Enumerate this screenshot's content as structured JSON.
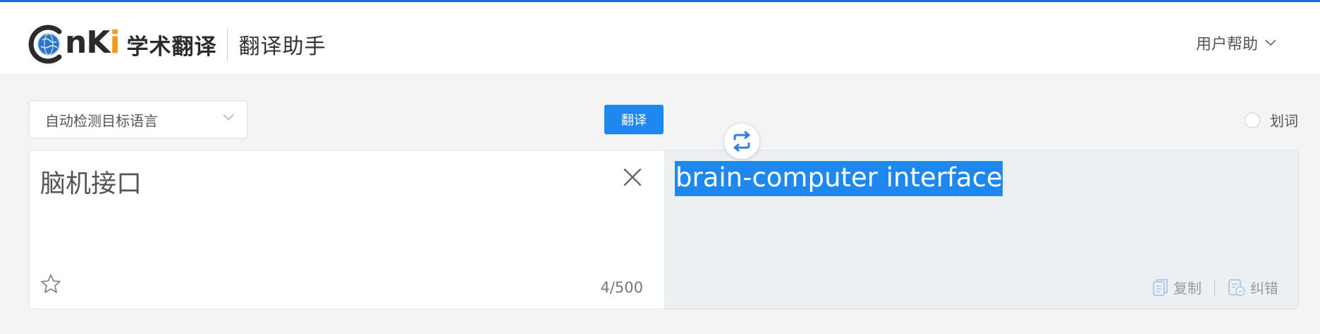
{
  "brand": {
    "logo_letters_left": "n",
    "logo_letters_k": "K",
    "logo_letters_i": "i",
    "title": "学术翻译",
    "subtitle": "翻译助手"
  },
  "header": {
    "help_label": "用户帮助"
  },
  "toolbar": {
    "source_language": "自动检测目标语言",
    "translate_label": "翻译",
    "selection_translate_label": "划词"
  },
  "source": {
    "text": "脑机接口",
    "char_count": "4/500"
  },
  "result": {
    "text": "brain-computer interface",
    "copy_label": "复制",
    "correct_label": "纠错"
  },
  "colors": {
    "accent": "#1e87f0",
    "top_bar": "#1e6ae0",
    "logo_dot": "#f39a1b",
    "result_bg": "#edf0f3"
  },
  "icons": [
    "globe-icon",
    "chevron-down-icon",
    "close-icon",
    "star-icon",
    "swap-icon",
    "copy-icon",
    "report-icon"
  ]
}
